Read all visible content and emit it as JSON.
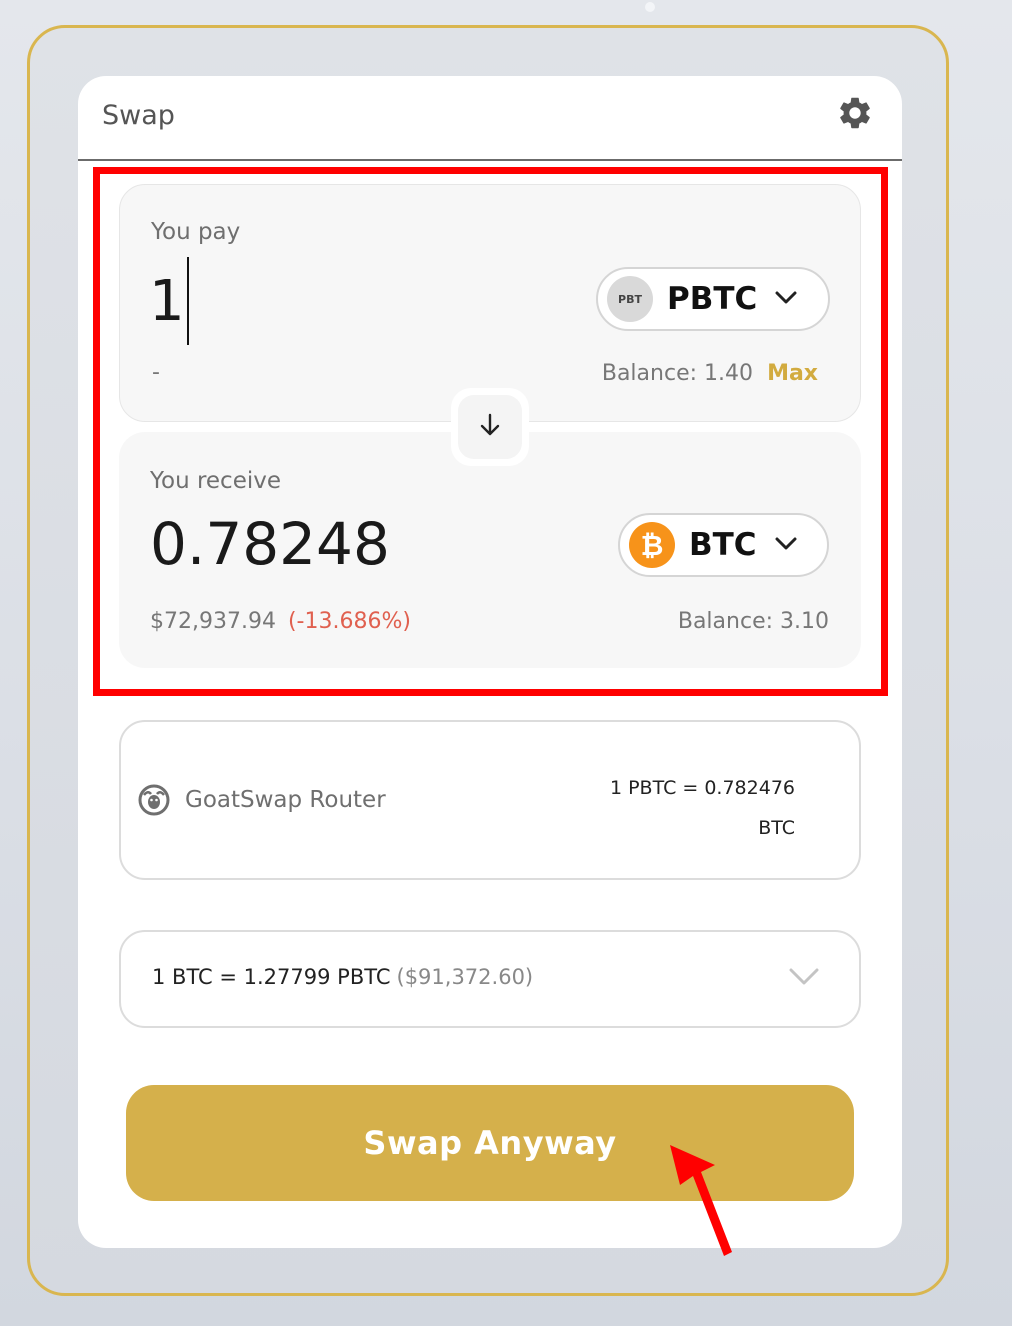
{
  "header": {
    "title": "Swap",
    "settings_icon": "gear-icon"
  },
  "pay": {
    "label": "You pay",
    "amount": "1",
    "token": {
      "symbol": "PBTC",
      "icon_text": "PBT"
    },
    "usd_value": "-",
    "balance": "Balance: 1.40",
    "max_label": "Max"
  },
  "switch": {
    "icon": "arrow-down-icon"
  },
  "receive": {
    "label": "You receive",
    "amount": "0.78248",
    "token": {
      "symbol": "BTC",
      "icon_glyph": "₿"
    },
    "usd_value": "$72,937.94",
    "price_impact": "(-13.686%)",
    "balance": "Balance: 3.10"
  },
  "route": {
    "router_name": "GoatSwap Router",
    "rate_line1": "1 PBTC = 0.782476",
    "rate_line2": "BTC"
  },
  "rate": {
    "text": "1 BTC = 1.27799 PBTC",
    "usd": "($91,372.60)"
  },
  "action": {
    "swap_label": "Swap Anyway"
  },
  "colors": {
    "accent": "#d5b04b",
    "max": "#d2ab3f",
    "negative": "#e0604f",
    "btc": "#f7931a",
    "annotation": "#ff0000"
  }
}
